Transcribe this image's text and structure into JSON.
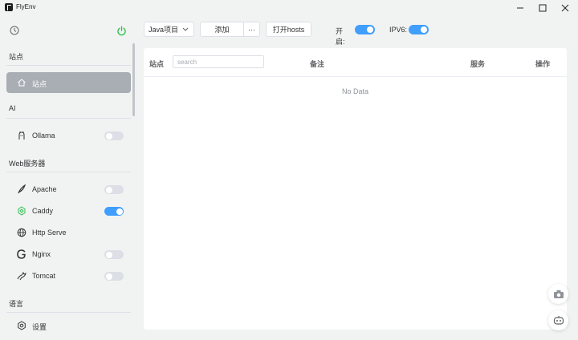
{
  "window": {
    "title": "FlyEnv",
    "minimize_icon": "minimize-icon",
    "maximize_icon": "maximize-icon",
    "close_icon": "close-icon"
  },
  "sidebar": {
    "top_icons": [
      "history-icon",
      "power-icon"
    ],
    "sections": [
      {
        "title": "站点",
        "items": [
          {
            "label": "站点",
            "icon": "home-icon",
            "active": true
          }
        ]
      },
      {
        "title": "AI",
        "items": [
          {
            "label": "Ollama",
            "icon": "ollama-icon",
            "toggle": false
          }
        ]
      },
      {
        "title": "Web服务器",
        "items": [
          {
            "label": "Apache",
            "icon": "apache-feather-icon",
            "toggle": false
          },
          {
            "label": "Caddy",
            "icon": "caddy-icon",
            "toggle": true
          },
          {
            "label": "Http Serve",
            "icon": "globe-icon"
          },
          {
            "label": "Nginx",
            "icon": "nginx-icon",
            "toggle": false
          },
          {
            "label": "Tomcat",
            "icon": "tomcat-icon",
            "toggle": false
          }
        ]
      },
      {
        "title": "语言",
        "items": [
          {
            "label": "设置",
            "icon": "settings-icon"
          }
        ]
      }
    ]
  },
  "toolbar": {
    "project_select": "Java项目",
    "add_label": "添加",
    "more_label": "···",
    "open_hosts_label": "打开hosts",
    "enable_label": "开启:",
    "enable_on": true,
    "ipv6_label": "IPV6:",
    "ipv6_on": true
  },
  "table": {
    "col_site": "站点",
    "search_placeholder": "search",
    "col_note": "备注",
    "col_service": "服务",
    "col_actions": "操作",
    "empty_text": "No Data"
  },
  "floating": [
    "camera-icon",
    "robot-icon"
  ],
  "colors": {
    "accent": "#409eff",
    "active_item": "#a9aeb4",
    "power_green": "#2fbf4f"
  }
}
